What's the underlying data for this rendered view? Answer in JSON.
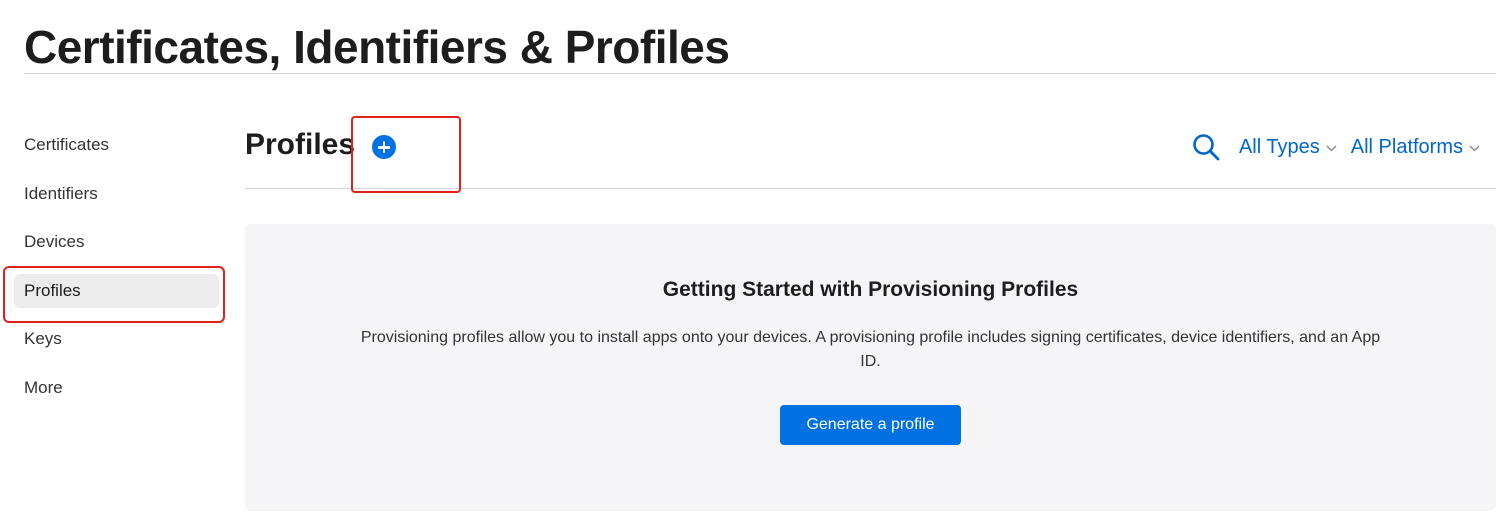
{
  "page": {
    "title": "Certificates, Identifiers & Profiles"
  },
  "sidebar": {
    "items": [
      {
        "label": "Certificates"
      },
      {
        "label": "Identifiers"
      },
      {
        "label": "Devices"
      },
      {
        "label": "Profiles",
        "active": true
      },
      {
        "label": "Keys"
      },
      {
        "label": "More"
      }
    ]
  },
  "section": {
    "title": "Profiles",
    "add_icon": "plus-circle-icon"
  },
  "filters": {
    "search_icon": "search-icon",
    "types_label": "All Types",
    "platforms_label": "All Platforms"
  },
  "card": {
    "title": "Getting Started with Provisioning Profiles",
    "description": "Provisioning profiles allow you to install apps onto your devices. A provisioning profile includes signing certificates, device identifiers, and an App ID.",
    "button_label": "Generate a profile"
  },
  "colors": {
    "accent": "#0071e3",
    "link": "#0066cc",
    "highlight": "#e0211b",
    "card_background": "#f5f5f7"
  }
}
